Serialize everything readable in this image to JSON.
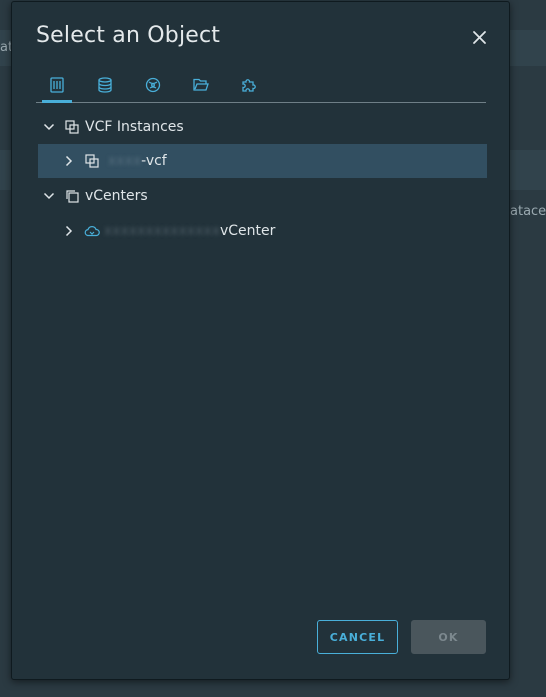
{
  "background": {
    "fragment_left_top": "at",
    "fragment_right": "atace"
  },
  "dialog": {
    "title": "Select an Object",
    "tabs": [
      {
        "icon": "datacenter-icon",
        "active": true
      },
      {
        "icon": "datastore-icon",
        "active": false
      },
      {
        "icon": "network-icon",
        "active": false
      },
      {
        "icon": "folder-icon",
        "active": false
      },
      {
        "icon": "plugin-icon",
        "active": false
      }
    ],
    "tree": {
      "vcf_group": {
        "label": "VCF Instances",
        "expanded": true
      },
      "vcf_item": {
        "label": "-vcf",
        "redacted_prefix": "xxxx",
        "selected": true
      },
      "vcenters_group": {
        "label": "vCenters",
        "expanded": true
      },
      "vcenter_item": {
        "label": "vCenter",
        "redacted_prefix": "xxxxxxxxxxxxxx",
        "selected": false
      }
    },
    "buttons": {
      "cancel": "CANCEL",
      "ok": "OK"
    }
  },
  "colors": {
    "accent": "#49afd9",
    "dialog_bg": "#22323a",
    "selected_row": "#324f61",
    "disabled_button": "#4a565c"
  }
}
